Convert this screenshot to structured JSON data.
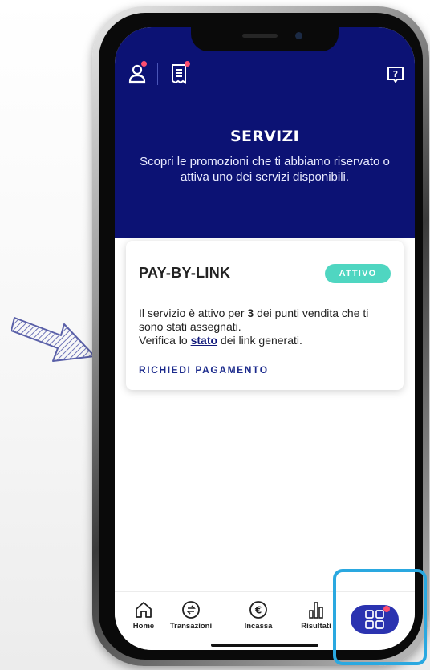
{
  "header": {
    "title": "SERVIZI",
    "subtitle": "Scopri le promozioni che ti abbiamo riservato o attiva uno dei servizi disponibili."
  },
  "card": {
    "title": "PAY-BY-LINK",
    "badge": "ATTIVO",
    "line1_pre": "Il servizio è attivo per ",
    "line1_num": "3",
    "line1_post": " dei punti vendita che ti sono stati assegnati.",
    "line2_pre": "Verifica lo ",
    "line2_link": "stato",
    "line2_post": " dei link generati.",
    "action": "RICHIEDI PAGAMENTO"
  },
  "tabbar": {
    "items": [
      {
        "label": "Home",
        "icon": "home-icon"
      },
      {
        "label": "Transazioni",
        "icon": "transactions-icon"
      },
      {
        "label": "Incassa",
        "icon": "euro-icon"
      },
      {
        "label": "Risultati",
        "icon": "bar-chart-icon"
      }
    ],
    "more_icon": "grid-icon"
  },
  "colors": {
    "header_bg": "#0c1274",
    "badge_bg": "#4fd6c1",
    "accent": "#2b33b0",
    "notification_dot": "#ff4f70",
    "highlight": "#2aa8e0"
  }
}
